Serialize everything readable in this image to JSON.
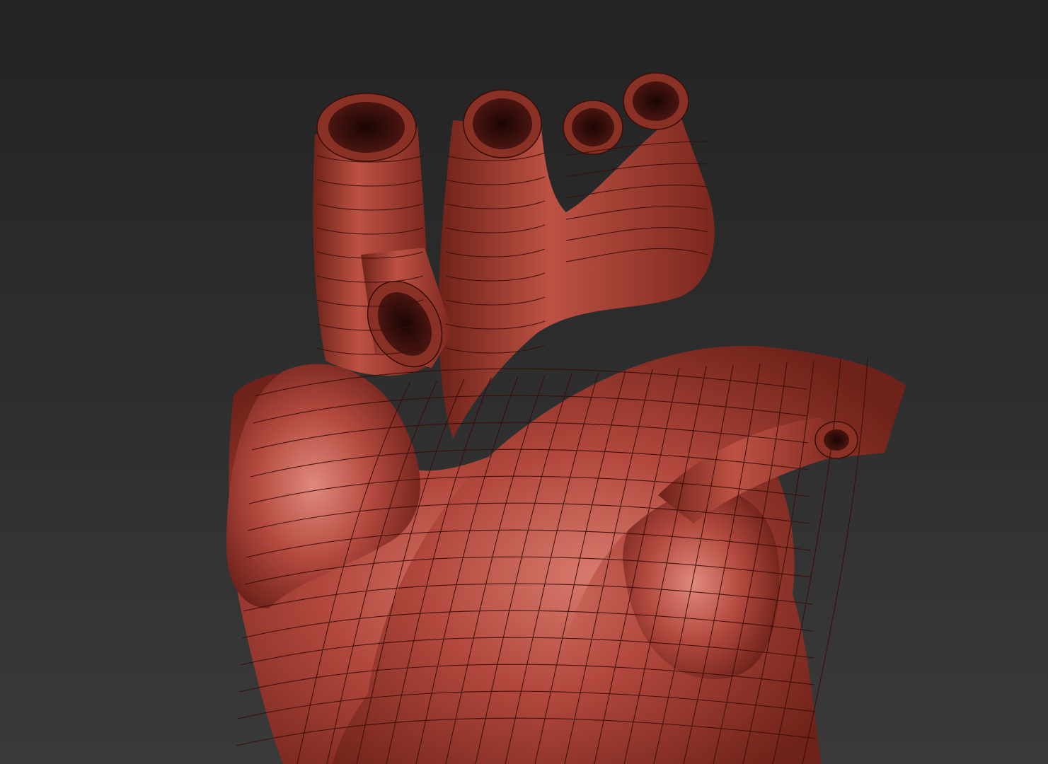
{
  "scene": {
    "subject": "heart-mesh",
    "colors": {
      "background_top": "#232323",
      "background_bottom": "#3a3a3a",
      "mesh_base": "#b2483d",
      "mesh_light": "#d77a6d",
      "mesh_shadow": "#5a1a14",
      "wireframe": "#3a0c08"
    }
  }
}
